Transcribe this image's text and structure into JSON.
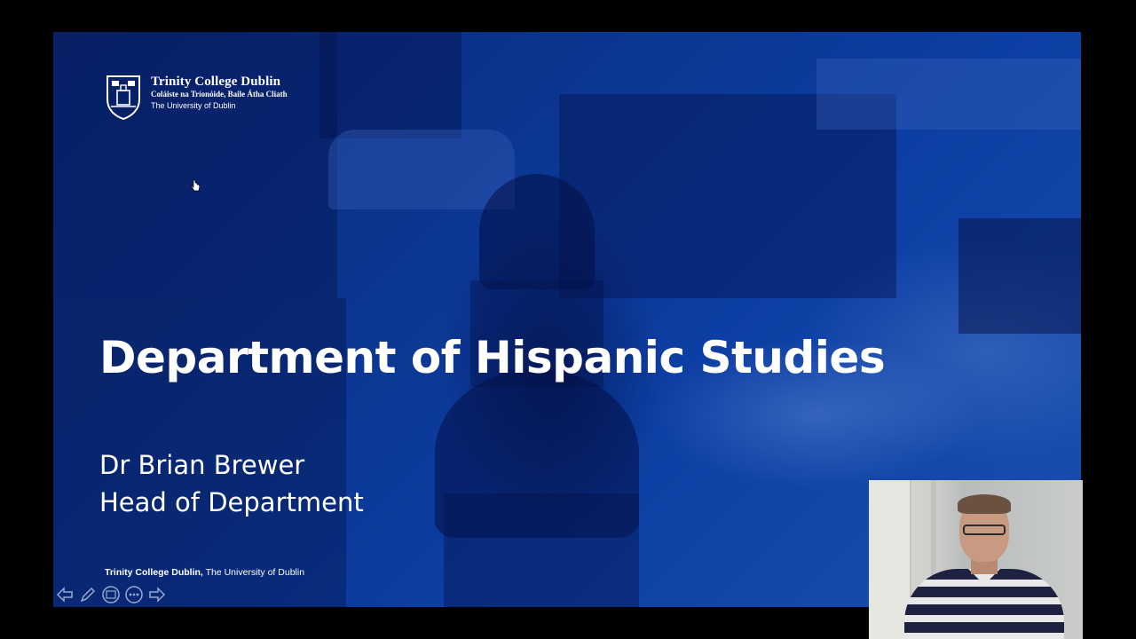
{
  "slide": {
    "logo": {
      "title": "Trinity College Dublin",
      "subtitle": "Coláiste na Tríonóide, Baile Átha Cliath",
      "tagline": "The University of Dublin"
    },
    "title": "Department of Hispanic Studies",
    "presenter_name": "Dr Brian Brewer",
    "presenter_role": "Head of Department",
    "footer_bold": "Trinity College Dublin,",
    "footer_rest": "The University of Dublin",
    "accent_color": "#0d3ea3"
  },
  "controls": {
    "icons": [
      "previous-icon",
      "pen-icon",
      "slides-icon",
      "more-icon",
      "next-icon"
    ]
  },
  "webcam": {
    "label": "presenter webcam"
  }
}
